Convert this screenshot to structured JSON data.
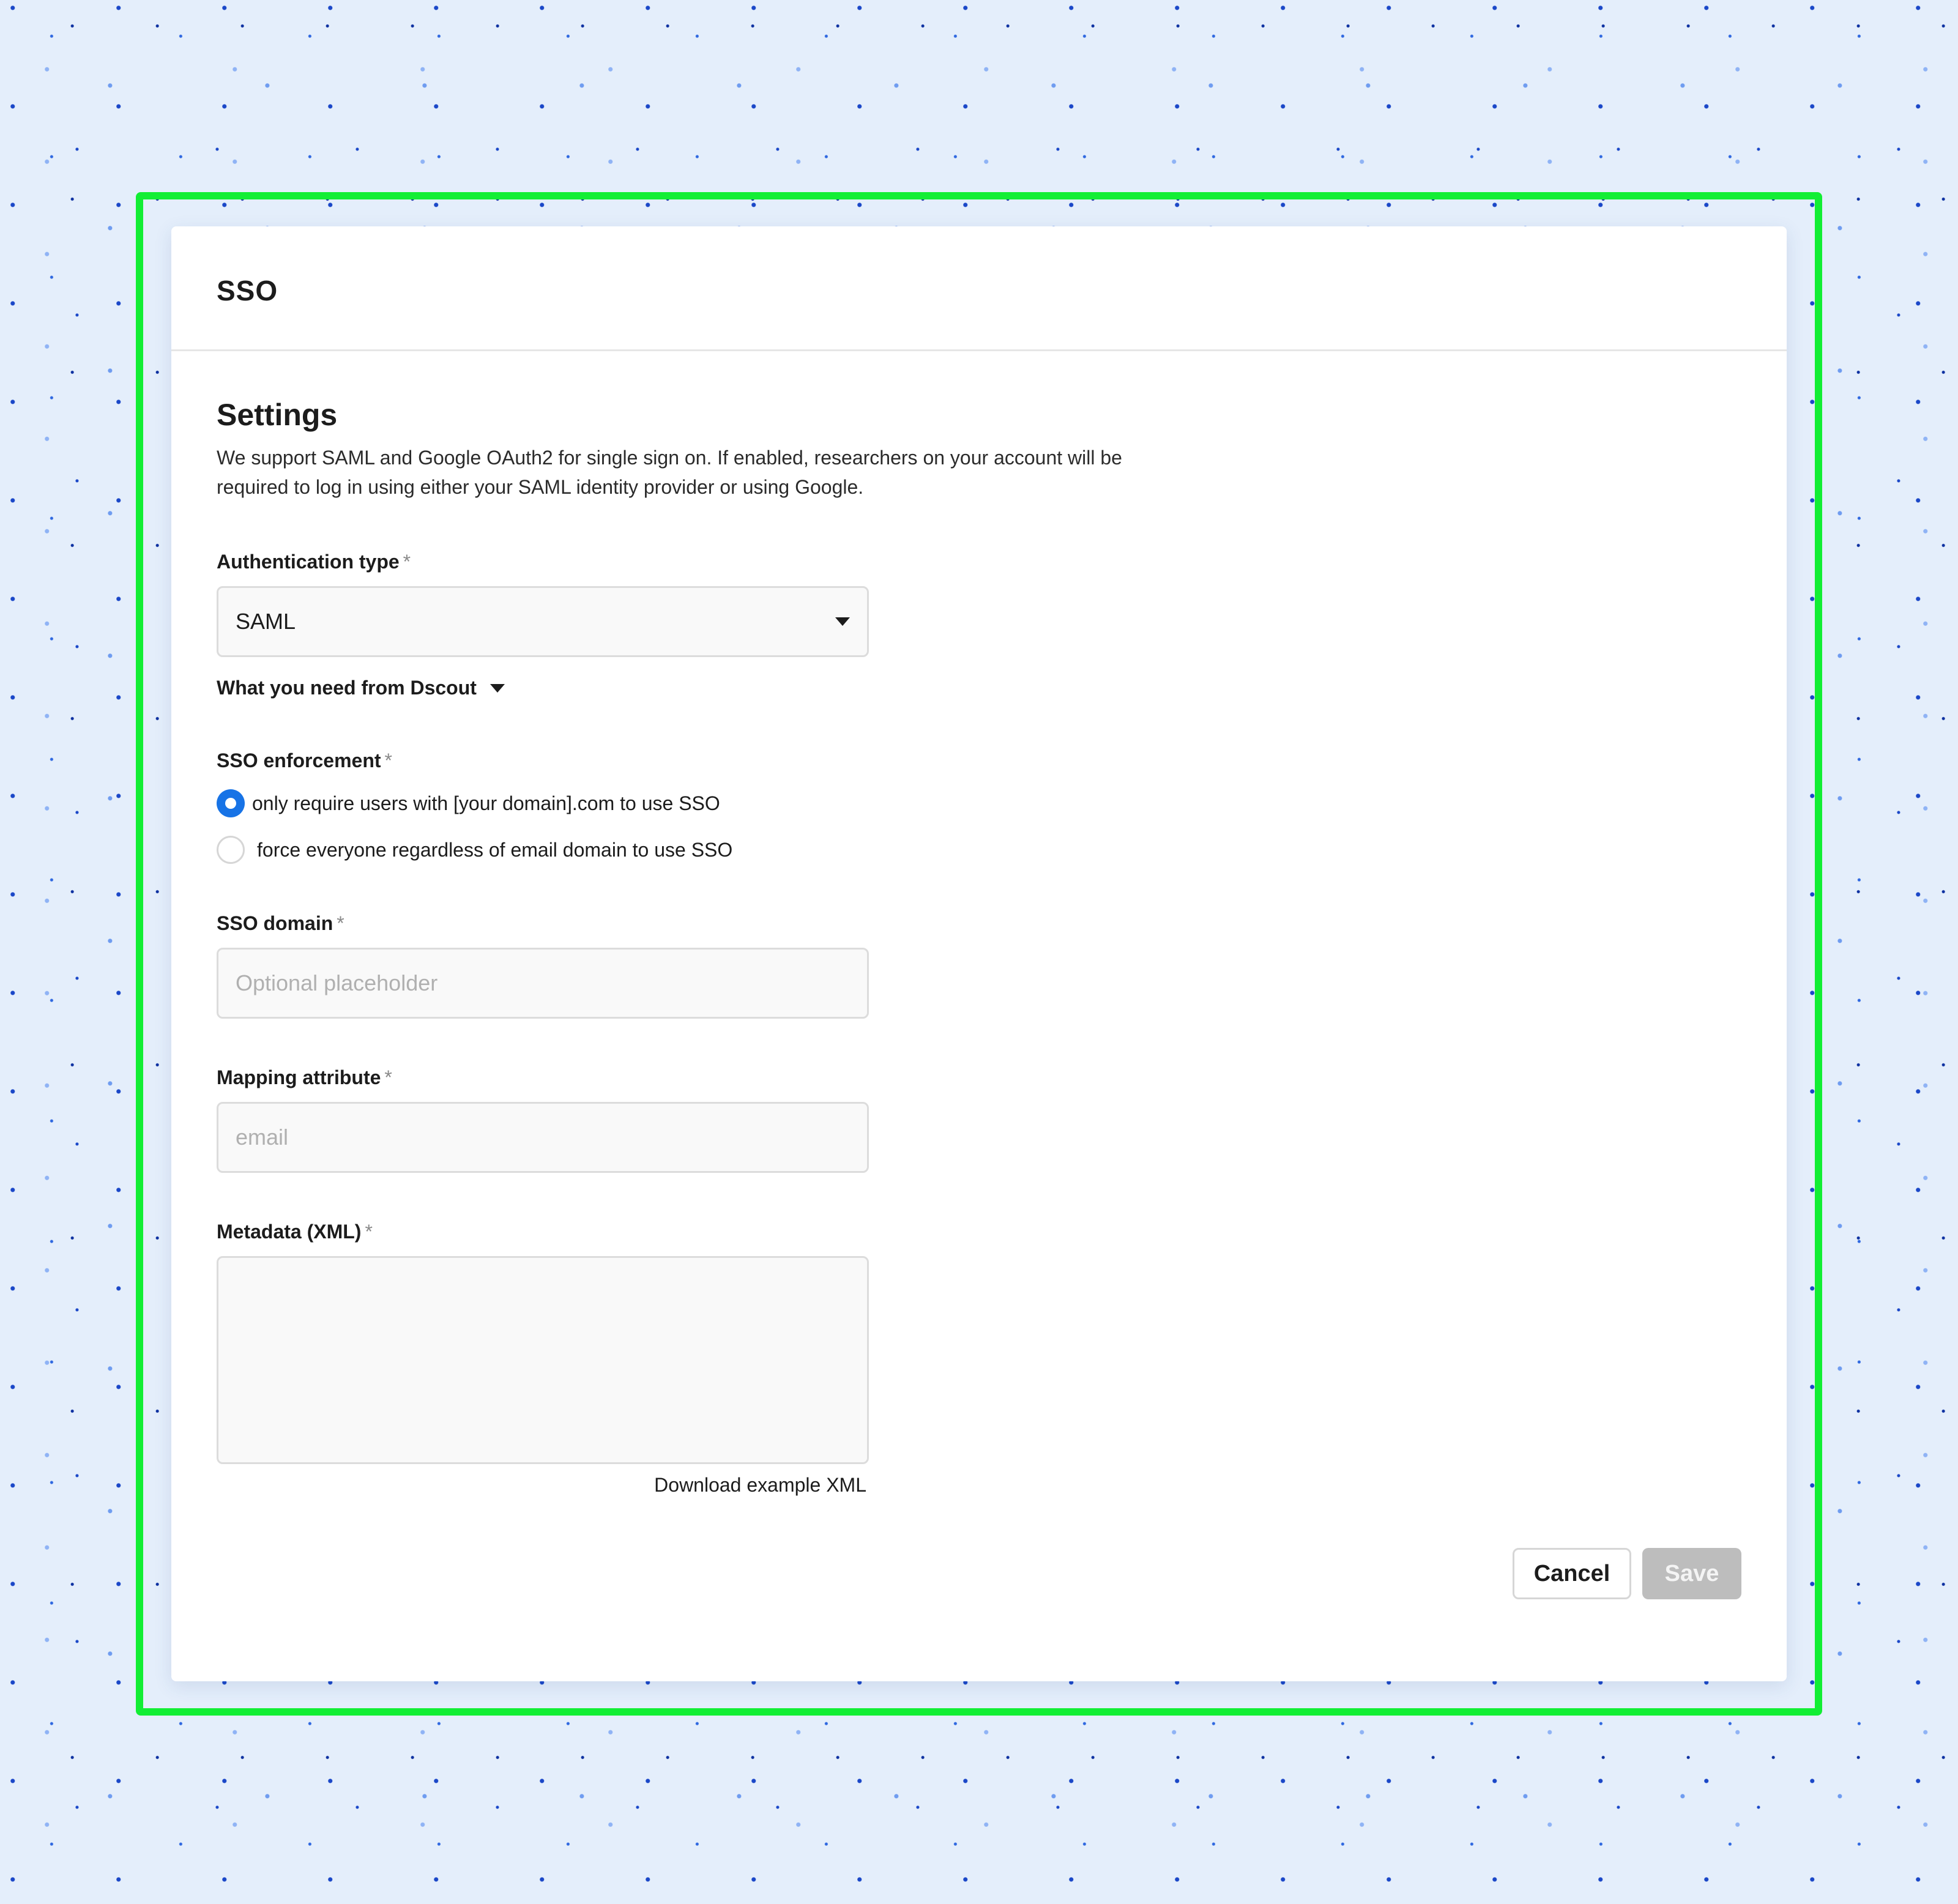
{
  "dialog": {
    "title": "SSO"
  },
  "settings": {
    "heading": "Settings",
    "description": "We support SAML and Google OAuth2 for single sign on. If enabled, researchers on your account will be required to log in using either your SAML identity provider or using Google."
  },
  "auth_type": {
    "label": "Authentication type",
    "required_mark": "*",
    "selected": "SAML",
    "options": [
      "SAML"
    ]
  },
  "disclosure": {
    "label": "What you need from Dscout"
  },
  "enforcement": {
    "label": "SSO enforcement",
    "required_mark": "*",
    "options": [
      {
        "label": "only require users with [your domain].com to use SSO",
        "checked": true
      },
      {
        "label": "force everyone regardless of email domain to use SSO",
        "checked": false
      }
    ]
  },
  "sso_domain": {
    "label": "SSO domain",
    "required_mark": "*",
    "value": "",
    "placeholder": "Optional placeholder"
  },
  "mapping": {
    "label": "Mapping attribute",
    "required_mark": "*",
    "value": "",
    "placeholder": "email"
  },
  "metadata": {
    "label": "Metadata (XML)",
    "required_mark": "*",
    "value": "",
    "download_link": "Download example XML"
  },
  "actions": {
    "cancel_label": "Cancel",
    "save_label": "Save"
  },
  "colors": {
    "accent": "#1773e6",
    "highlight_outline": "#12ee34",
    "background": "#e4eefb",
    "disabled_button": "#bdbdbd"
  }
}
